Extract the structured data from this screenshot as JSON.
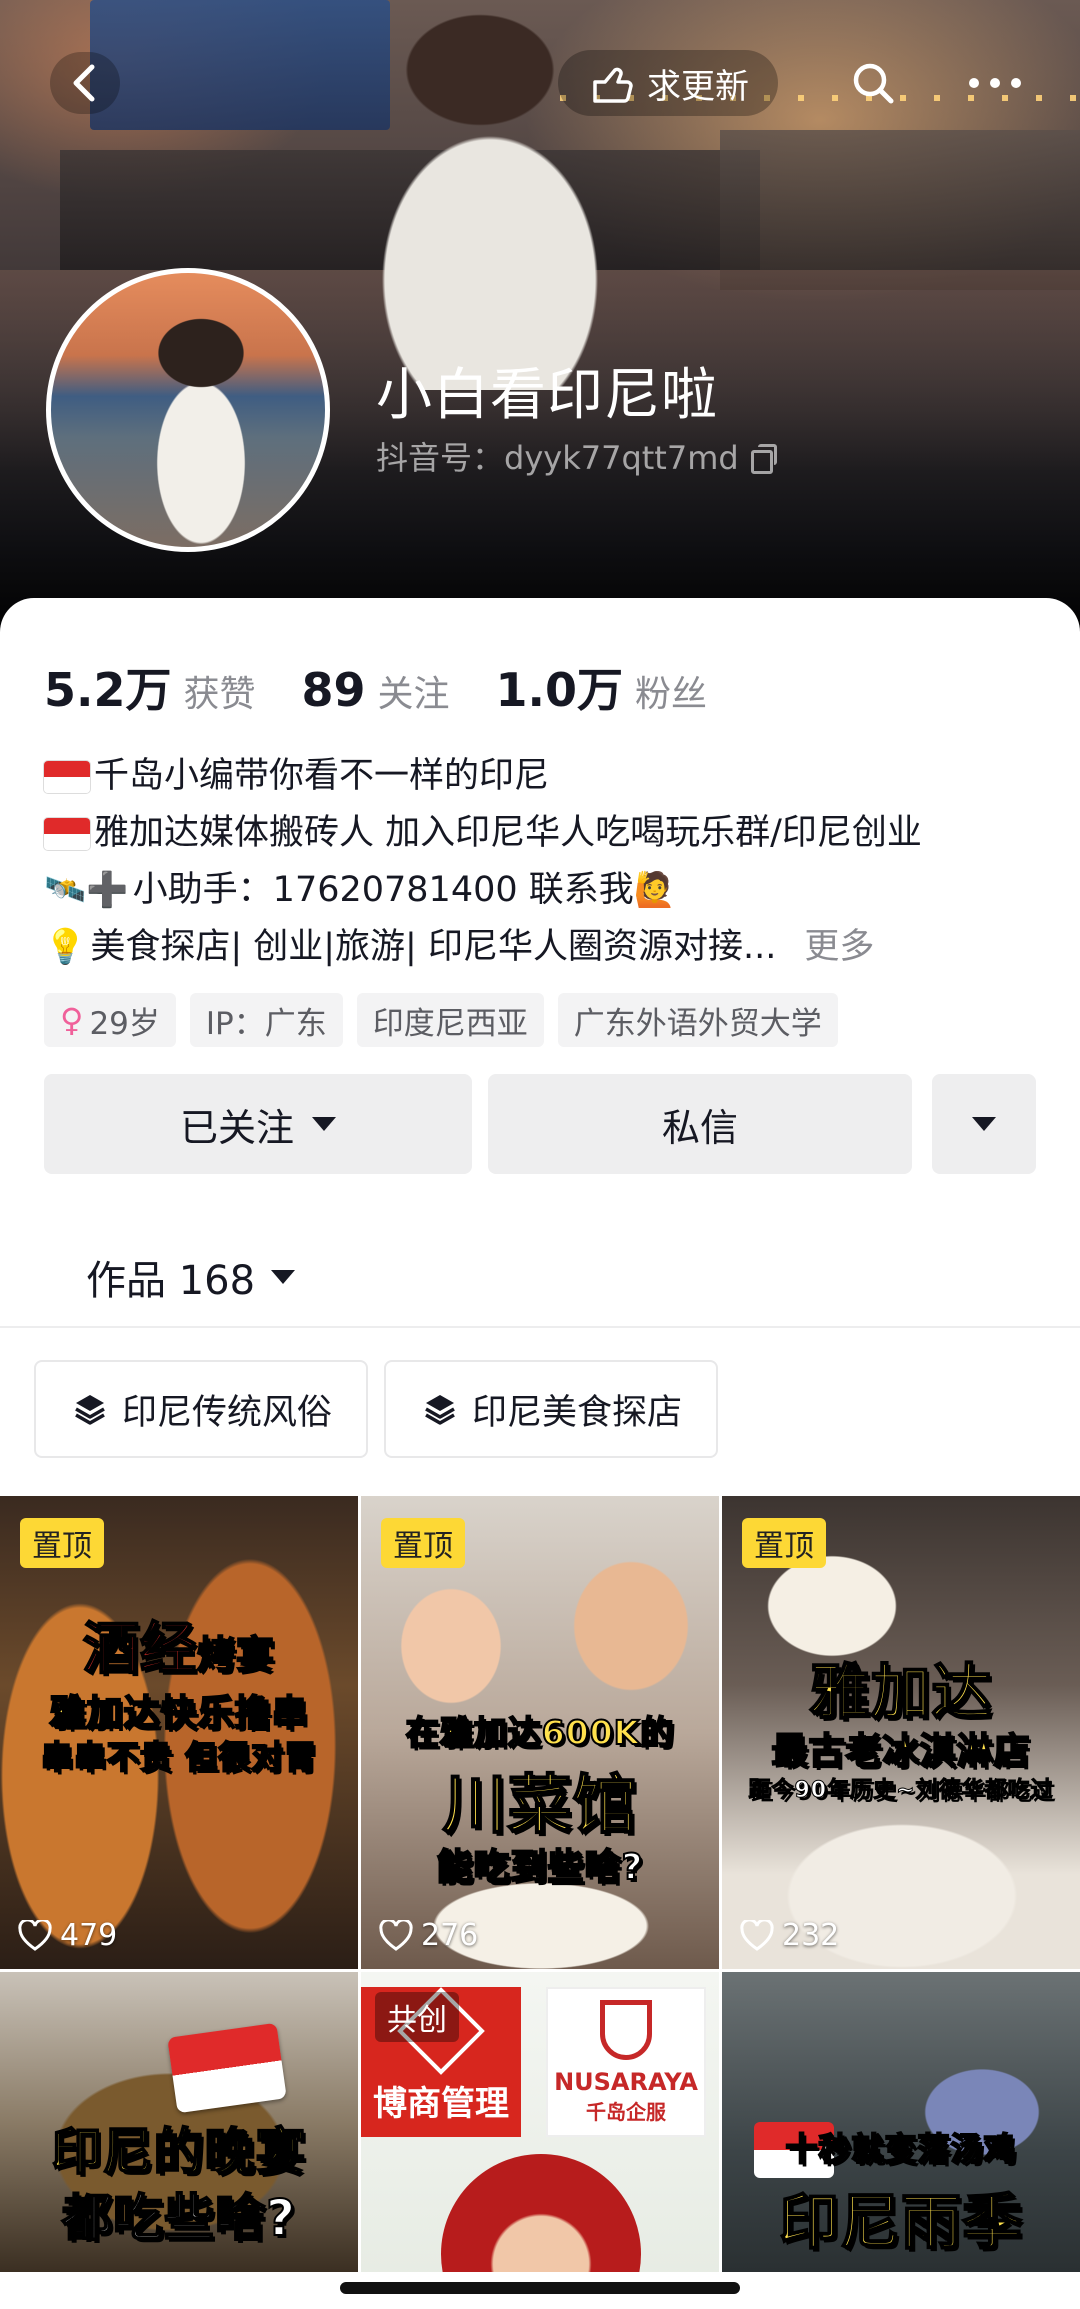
{
  "top_bar": {
    "update_label": "求更新"
  },
  "profile": {
    "name": "小白看印尼啦",
    "handle": "抖音号：dyyk77qtt7md"
  },
  "stats": [
    {
      "value": "5.2万",
      "label": "获赞"
    },
    {
      "value": "89",
      "label": "关注"
    },
    {
      "value": "1.0万",
      "label": "粉丝"
    }
  ],
  "bio": {
    "line1": "千岛小编带你看不一样的印尼",
    "line2": "雅加达媒体搬砖人  加入印尼华人吃喝玩乐群/印尼创业",
    "line3_prefix": "🛰️➕",
    "line3": "小助手：17620781400 联系我",
    "line3_suffix": "🙋",
    "line4_prefix": "💡",
    "line4": "美食探店| 创业|旅游| 印尼华人圈资源对接...",
    "more": "更多"
  },
  "tags": [
    "29岁",
    "IP：广东",
    "印度尼西亚",
    "广东外语外贸大学"
  ],
  "actions": {
    "follow": "已关注",
    "message": "私信"
  },
  "works": {
    "label": "作品 168"
  },
  "collections": [
    "印尼传统风俗",
    "印尼美食探店"
  ],
  "videos": [
    {
      "pinned": "置顶",
      "likes": "479",
      "cap_a": "酒经",
      "cap_a2": "烤宴",
      "cap_b": "雅加达快乐撸串",
      "cap_c": "串串不贵 但很对胃"
    },
    {
      "pinned": "置顶",
      "likes": "276",
      "cap_a": "在雅加达600K的",
      "cap_b": "川菜馆",
      "cap_c": "能吃到些啥?"
    },
    {
      "pinned": "置顶",
      "likes": "232",
      "cap_a": "雅加达",
      "cap_b": "最古老冰淇淋店",
      "cap_c": "距今90年历史~刘德华都吃过"
    },
    {
      "cap_a": "印尼的晚宴",
      "cap_b": "都吃些啥?"
    },
    {
      "badge": "共创",
      "brand1": "博商管理",
      "brand2": "NUSARAYA",
      "brand2_sub": "千岛企服"
    },
    {
      "cap_a": "十秒就变落汤鸡",
      "cap_b": "印尼雨季"
    }
  ],
  "colors": {
    "pin_bg": "#fdd835",
    "caption_yellow": "#ffe14d",
    "caption_red": "#e8302a",
    "secondary_text": "#8a8b91"
  }
}
